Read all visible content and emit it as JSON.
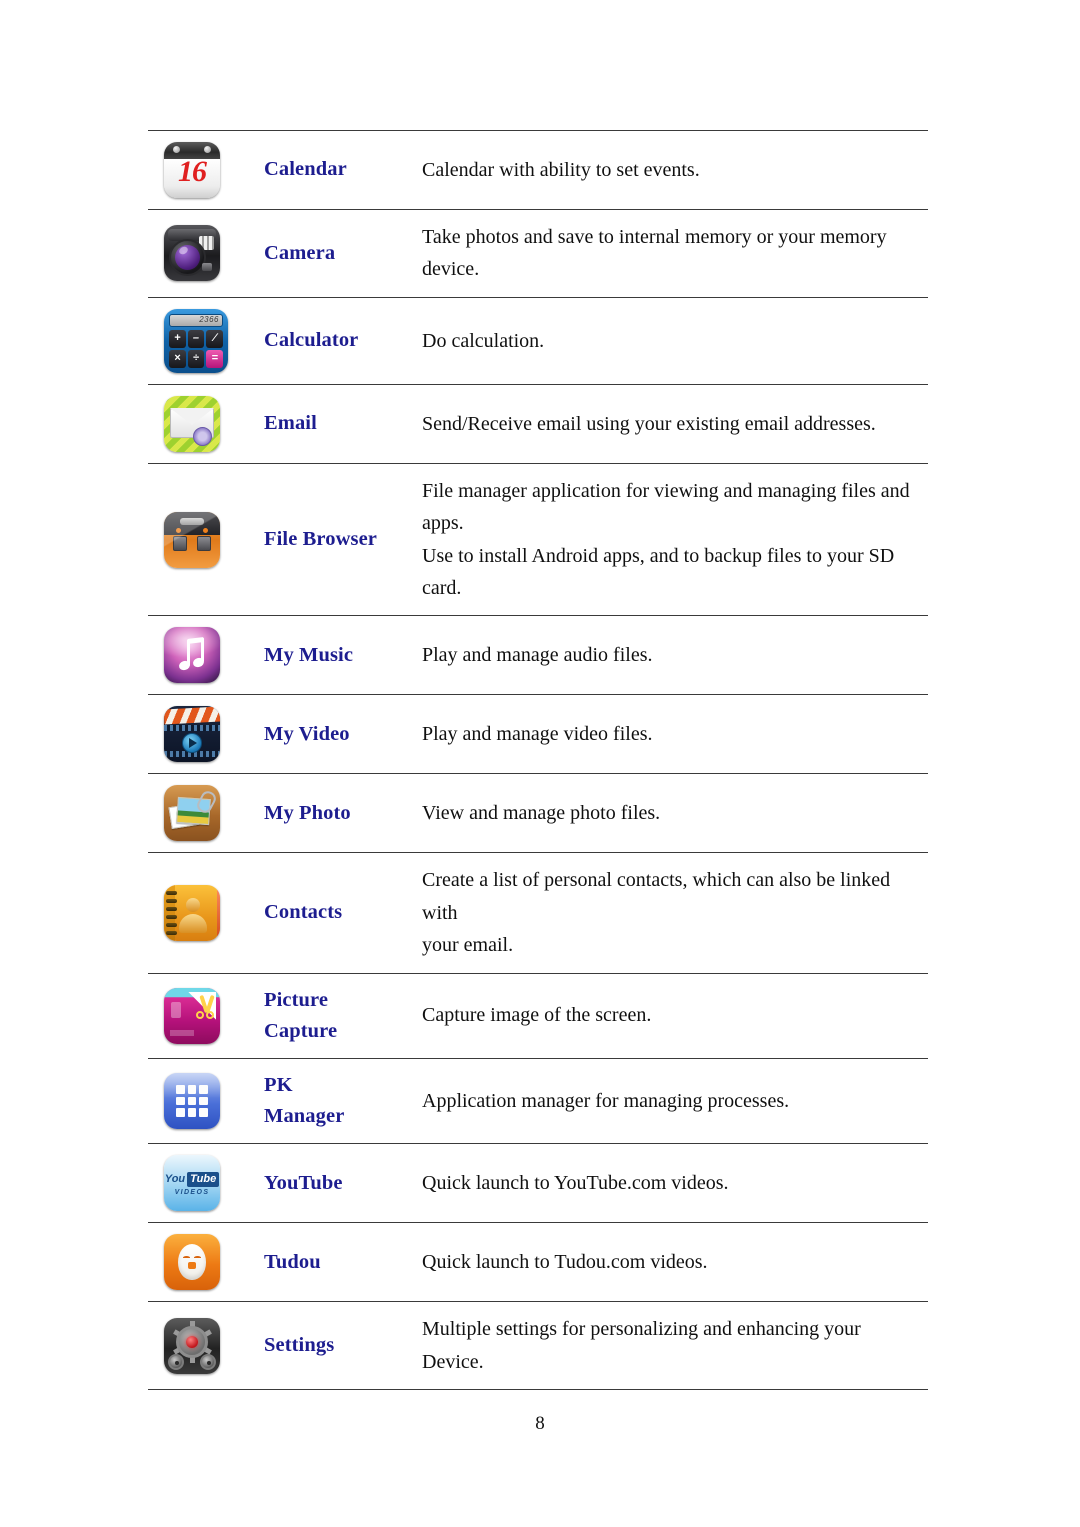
{
  "document": {
    "page_number": "8"
  },
  "table": {
    "rows": [
      {
        "icon": "calendar-icon",
        "name": "Calendar",
        "desc_line1": "Calendar with ability to set events.",
        "desc_line2": ""
      },
      {
        "icon": "camera-icon",
        "name": "Camera",
        "desc_line1": "Take photos and save to internal memory or your memory device.",
        "desc_line2": ""
      },
      {
        "icon": "calculator-icon",
        "name": "Calculator",
        "desc_line1": "Do calculation.",
        "desc_line2": ""
      },
      {
        "icon": "email-icon",
        "name": "Email",
        "desc_line1": "Send/Receive email using your existing email addresses.",
        "desc_line2": ""
      },
      {
        "icon": "file-browser-icon",
        "name": "File Browser",
        "desc_line1": "File manager application for viewing and managing files and apps.",
        "desc_line2": "Use to install Android apps, and to backup files to your SD card."
      },
      {
        "icon": "my-music-icon",
        "name": "My Music",
        "desc_line1": "Play and manage audio files.",
        "desc_line2": ""
      },
      {
        "icon": "my-video-icon",
        "name": "My Video",
        "desc_line1": "Play and manage video files.",
        "desc_line2": ""
      },
      {
        "icon": "my-photo-icon",
        "name": "My Photo",
        "desc_line1": "View and manage photo files.",
        "desc_line2": ""
      },
      {
        "icon": "contacts-icon",
        "name": "Contacts",
        "desc_line1": "Create a list of personal contacts, which can also be linked with",
        "desc_line2": "your email."
      },
      {
        "icon": "picture-capture-icon",
        "name": "Picture Capture",
        "name_line1": "Picture",
        "name_line2": "Capture",
        "desc_line1": "Capture image of the screen.",
        "desc_line2": ""
      },
      {
        "icon": "pk-manager-icon",
        "name": "PK Manager",
        "name_line1": "PK",
        "name_line2": "Manager",
        "desc_line1": "Application manager for managing processes.",
        "desc_line2": ""
      },
      {
        "icon": "youtube-icon",
        "name": "YouTube",
        "desc_line1": "Quick launch to YouTube.com videos.",
        "desc_line2": ""
      },
      {
        "icon": "tudou-icon",
        "name": "Tudou",
        "desc_line1": "Quick launch to Tudou.com videos.",
        "desc_line2": ""
      },
      {
        "icon": "settings-icon",
        "name": "Settings",
        "desc_line1": "Multiple settings for personalizing and enhancing your Device.",
        "desc_line2": ""
      }
    ]
  },
  "icon_text": {
    "calendar_day": "16",
    "calculator_display": "2366",
    "calculator_keys": [
      "+",
      "–",
      "∕",
      "×",
      "÷",
      "="
    ],
    "youtube_you": "You",
    "youtube_tube": "Tube",
    "youtube_videos": "VIDEOS"
  },
  "colors": {
    "app_name": "#1d1d8f",
    "body_text": "#101010",
    "rule": "#3a3a3a"
  }
}
